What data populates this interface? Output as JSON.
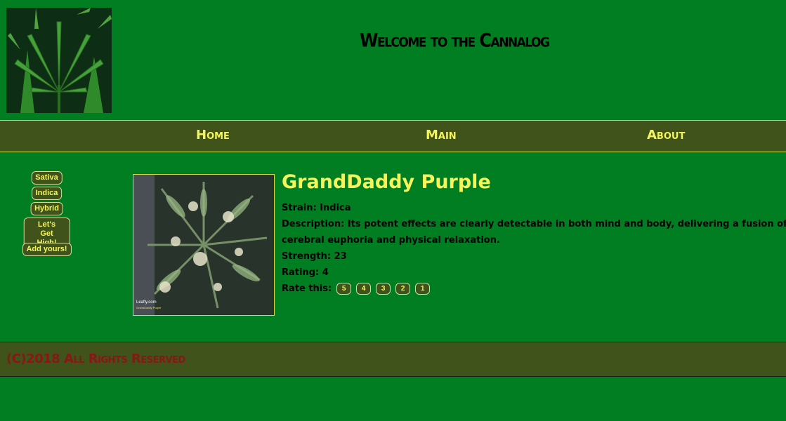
{
  "header": {
    "title": "Welcome to the Cannalog",
    "logo_icon": "cannabis-leaf-icon"
  },
  "nav": {
    "items": [
      {
        "label": "Home"
      },
      {
        "label": "Main"
      },
      {
        "label": "About"
      }
    ]
  },
  "sidebar": {
    "items": [
      {
        "label": "Sativa"
      },
      {
        "label": "Indica"
      },
      {
        "label": "Hybrid"
      },
      {
        "label": "Let's Get\nHigh!"
      },
      {
        "label": "Add yours!"
      }
    ]
  },
  "strain": {
    "name": "GrandDaddy Purple",
    "image_caption": "Leafly.com",
    "image_subcaption": "GrandDaddy Purple",
    "strain_label": "Strain:",
    "strain_value": "Indica",
    "description_label": "Description:",
    "description_value": "Its potent effects are clearly detectable in both mind and body, delivering a fusion of cerebral euphoria and physical relaxation.",
    "strength_label": "Strength:",
    "strength_value": "23",
    "rating_label": "Rating:",
    "rating_value": "4",
    "rate_label": "Rate this:",
    "rate_options": [
      "5",
      "4",
      "3",
      "2",
      "1"
    ]
  },
  "footer": {
    "text": "(C)2018 All Rights Reserved"
  },
  "colors": {
    "page_background": "#017d22",
    "bar_background": "#3f531b",
    "accent_yellow": "#f5f55b",
    "footer_text": "#8a1616"
  }
}
